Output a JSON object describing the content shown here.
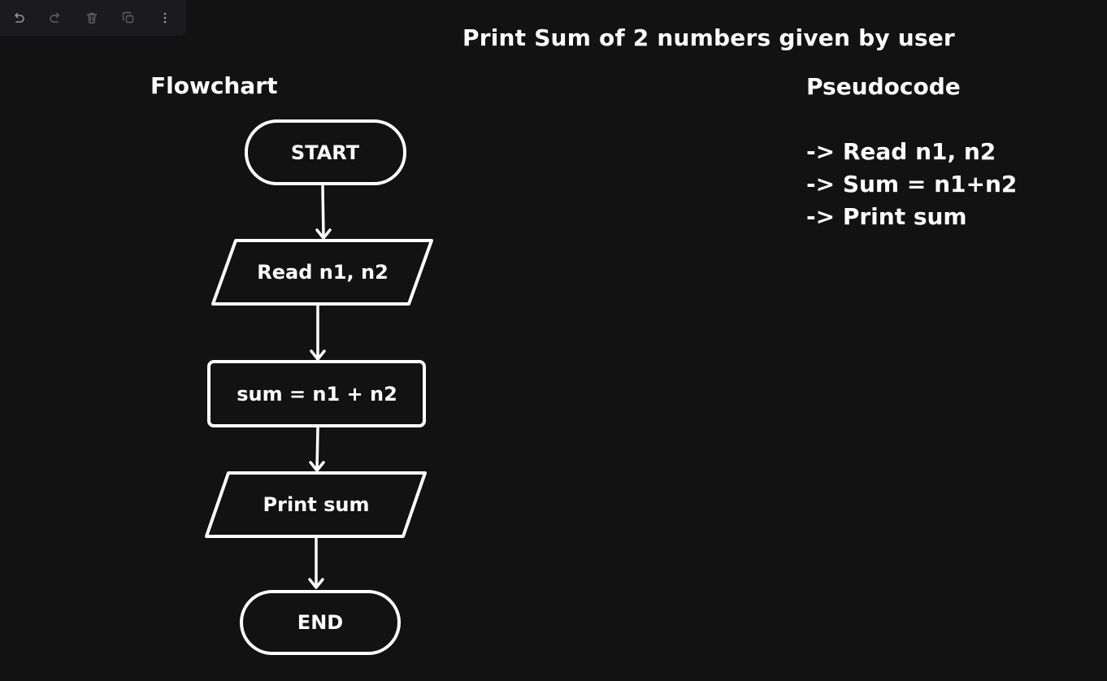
{
  "toolbar": {
    "buttons": [
      {
        "name": "undo-button",
        "icon": "undo-icon"
      },
      {
        "name": "redo-button",
        "icon": "redo-icon"
      },
      {
        "name": "delete-button",
        "icon": "trash-icon"
      },
      {
        "name": "duplicate-button",
        "icon": "duplicate-icon"
      },
      {
        "name": "more-button",
        "icon": "more-vertical-icon"
      }
    ]
  },
  "page_title": "Print Sum of 2 numbers given by user",
  "flowchart": {
    "heading": "Flowchart",
    "nodes": [
      {
        "id": "start",
        "shape": "terminal",
        "label": "START"
      },
      {
        "id": "read",
        "shape": "io",
        "label": "Read n1, n2"
      },
      {
        "id": "sum",
        "shape": "process",
        "label": "sum = n1 + n2"
      },
      {
        "id": "print",
        "shape": "io",
        "label": "Print sum"
      },
      {
        "id": "end",
        "shape": "terminal",
        "label": "END"
      }
    ]
  },
  "pseudocode": {
    "heading": "Pseudocode",
    "lines": [
      "-> Read n1, n2",
      "-> Sum = n1+n2",
      "-> Print sum"
    ]
  },
  "colors": {
    "background": "#121212",
    "foreground": "#ffffff",
    "toolbar": "#1b1b1d"
  }
}
